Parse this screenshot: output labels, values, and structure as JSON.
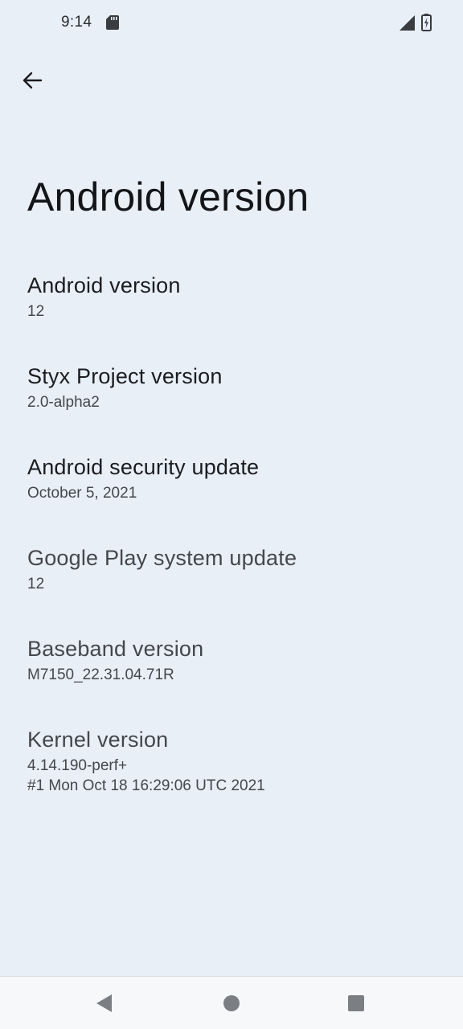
{
  "status_bar": {
    "time": "9:14",
    "icons": [
      "sd-card-icon",
      "signal-icon",
      "battery-charging-icon"
    ]
  },
  "header": {
    "back_icon": "arrow-back-icon",
    "title": "Android version"
  },
  "items": [
    {
      "title": "Android version",
      "summary": [
        "12"
      ]
    },
    {
      "title": "Styx Project version",
      "summary": [
        "2.0-alpha2"
      ]
    },
    {
      "title": "Android security update",
      "summary": [
        "October 5, 2021"
      ]
    },
    {
      "title": "Google Play system update",
      "summary": [
        "12"
      ]
    },
    {
      "title": "Baseband version",
      "summary": [
        "M7150_22.31.04.71R"
      ]
    },
    {
      "title": "Kernel version",
      "summary": [
        "4.14.190-perf+",
        "#1 Mon Oct 18 16:29:06 UTC 2021"
      ]
    }
  ],
  "nav_bar": {
    "icons": [
      "nav-back-icon",
      "nav-home-icon",
      "nav-recents-icon"
    ]
  },
  "colors": {
    "background": "#e8eff7",
    "text_primary": "#1b1c1f",
    "text_secondary": "#44474c",
    "nav_bar": "#f7f8fa"
  }
}
